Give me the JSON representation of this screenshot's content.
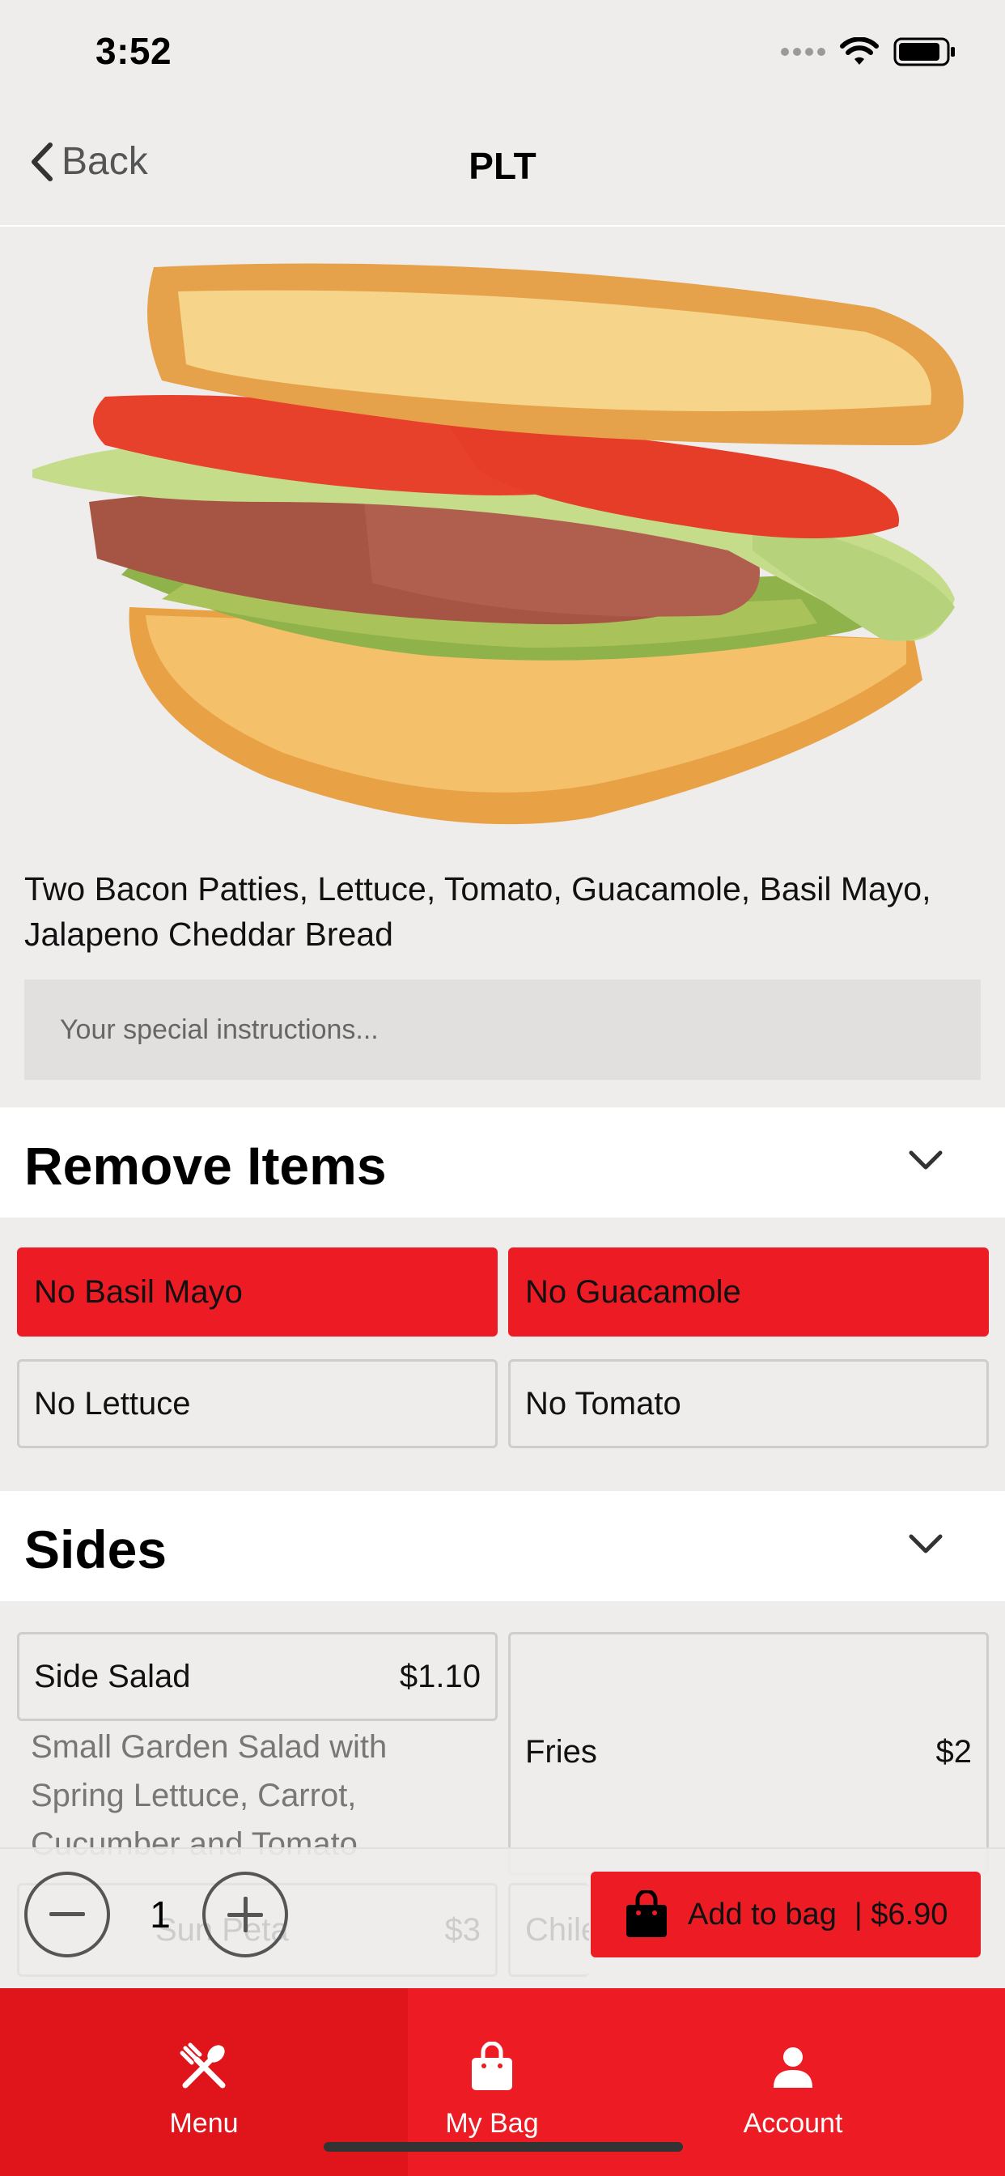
{
  "status": {
    "time": "3:52"
  },
  "nav": {
    "back_label": "Back",
    "title": "PLT"
  },
  "item": {
    "description": "Two Bacon Patties, Lettuce, Tomato, Guacamole, Basil Mayo, Jalapeno Cheddar Bread",
    "instructions_placeholder": "Your special instructions..."
  },
  "remove": {
    "title": "Remove Items",
    "options": [
      {
        "label": "No Basil Mayo",
        "selected": true
      },
      {
        "label": "No Guacamole",
        "selected": true
      },
      {
        "label": "No Lettuce",
        "selected": false
      },
      {
        "label": "No Tomato",
        "selected": false
      }
    ]
  },
  "sides": {
    "title": "Sides",
    "items": [
      {
        "name": "Side Salad",
        "price": "$1.10",
        "description": "Small Garden Salad with Spring Lettuce, Carrot, Cucumber and Tomato"
      },
      {
        "name": "Fries",
        "price": "$2"
      },
      {
        "name": "Sun Peta",
        "price": "$3"
      },
      {
        "name": "Chile"
      }
    ]
  },
  "order": {
    "quantity": "1",
    "add_label": "Add to bag",
    "price": "| $6.90"
  },
  "tabs": [
    {
      "label": "Menu",
      "icon": "fork-spoon-icon",
      "active": true
    },
    {
      "label": "My Bag",
      "icon": "bag-icon",
      "active": false
    },
    {
      "label": "Account",
      "icon": "person-icon",
      "active": false
    }
  ],
  "colors": {
    "accent": "#ed1c24",
    "background": "#efedec"
  }
}
